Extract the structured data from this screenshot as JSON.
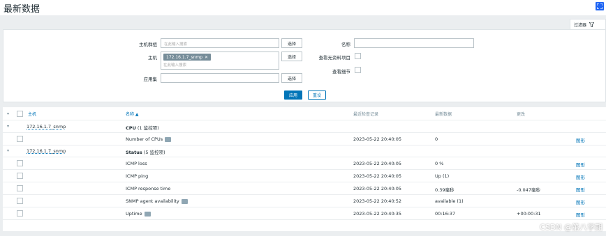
{
  "page": {
    "title": "最新数据"
  },
  "filter": {
    "tab_label": "过滤器",
    "host_groups_label": "主机群组",
    "host_groups_placeholder": "在此输入搜索",
    "hosts_label": "主机",
    "hosts_tag": "172.16.1.7_snmp",
    "hosts_placeholder": "在此输入搜索",
    "app_label": "应用集",
    "select_label": "选择",
    "name_label": "名称",
    "show_no_data_label": "查看无资料项目",
    "show_details_label": "查看细节",
    "apply_label": "应用",
    "reset_label": "重设"
  },
  "table": {
    "headers": {
      "host": "主机",
      "name": "名称 ▲",
      "last_check": "最近检查记录",
      "last_value": "最新数据",
      "change": "更改"
    },
    "groups": [
      {
        "host": "172.16.1.7_snmp",
        "app": "CPU",
        "count": "(1 监控项)",
        "rows": [
          {
            "name": "Number of CPUs",
            "last_check": "2023-05-22 20:40:05",
            "last_value": "0",
            "change": "",
            "action": "图形"
          }
        ]
      },
      {
        "host": "172.16.1.7_snmp",
        "app": "Status",
        "count": "(5 监控项)",
        "rows": [
          {
            "name": "ICMP loss",
            "last_check": "2023-05-22 20:40:05",
            "last_value": "0 %",
            "change": "",
            "action": "图形"
          },
          {
            "name": "ICMP ping",
            "last_check": "2023-05-22 20:40:05",
            "last_value": "Up (1)",
            "change": "",
            "action": "图形"
          },
          {
            "name": "ICMP response time",
            "last_check": "2023-05-22 20:40:05",
            "last_value": "0.39毫秒",
            "change": "-0.047毫秒",
            "action": "图形"
          },
          {
            "name": "SNMP agent availability",
            "last_check": "2023-05-22 20:40:52",
            "last_value": "available (1)",
            "change": "",
            "action": "图形"
          },
          {
            "name": "Uptime",
            "last_check": "2023-05-22 20:40:35",
            "last_value": "00:16:37",
            "change": "+00:00:31",
            "action": "图形"
          }
        ]
      }
    ]
  },
  "watermark": "CSDN @第八学期",
  "colors": {
    "accent": "#0275b8",
    "fullscreen": "#1f65f4",
    "background": "#ebeef0"
  }
}
